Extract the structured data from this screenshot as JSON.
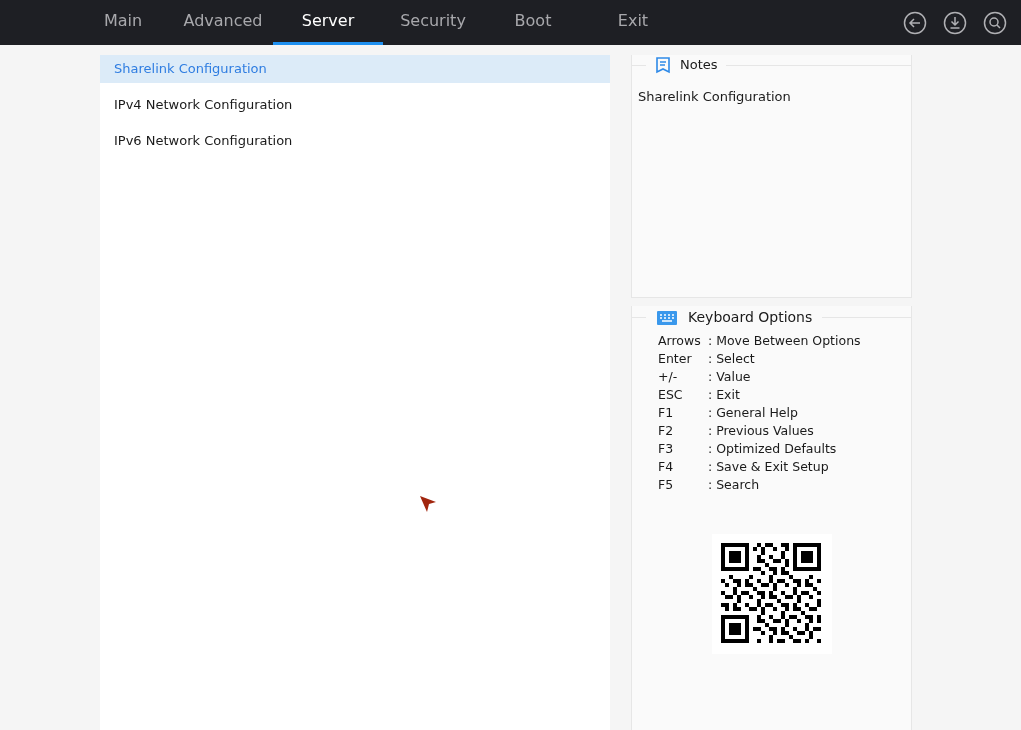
{
  "tabs": [
    {
      "label": "Main",
      "selected": false
    },
    {
      "label": "Advanced",
      "selected": false
    },
    {
      "label": "Server",
      "selected": true
    },
    {
      "label": "Security",
      "selected": false
    },
    {
      "label": "Boot",
      "selected": false
    },
    {
      "label": "Exit",
      "selected": false
    }
  ],
  "menu_items": [
    {
      "label": "Sharelink Configuration",
      "selected": true
    },
    {
      "label": "IPv4 Network Configuration",
      "selected": false
    },
    {
      "label": "IPv6 Network Configuration",
      "selected": false
    }
  ],
  "notes": {
    "title": "Notes",
    "text": "Sharelink Configuration"
  },
  "keyboard_options": {
    "title": "Keyboard Options",
    "items": [
      {
        "key": "Arrows",
        "description": ": Move Between Options"
      },
      {
        "key": "Enter",
        "description": ": Select"
      },
      {
        "key": "+/-",
        "description": ": Value"
      },
      {
        "key": "ESC",
        "description": ": Exit"
      },
      {
        "key": "F1",
        "description": ": General Help"
      },
      {
        "key": "F2",
        "description": ": Previous Values"
      },
      {
        "key": "F3",
        "description": ": Optimized Defaults"
      },
      {
        "key": "F4",
        "description": ": Save & Exit Setup"
      },
      {
        "key": "F5",
        "description": ": Search"
      }
    ]
  }
}
